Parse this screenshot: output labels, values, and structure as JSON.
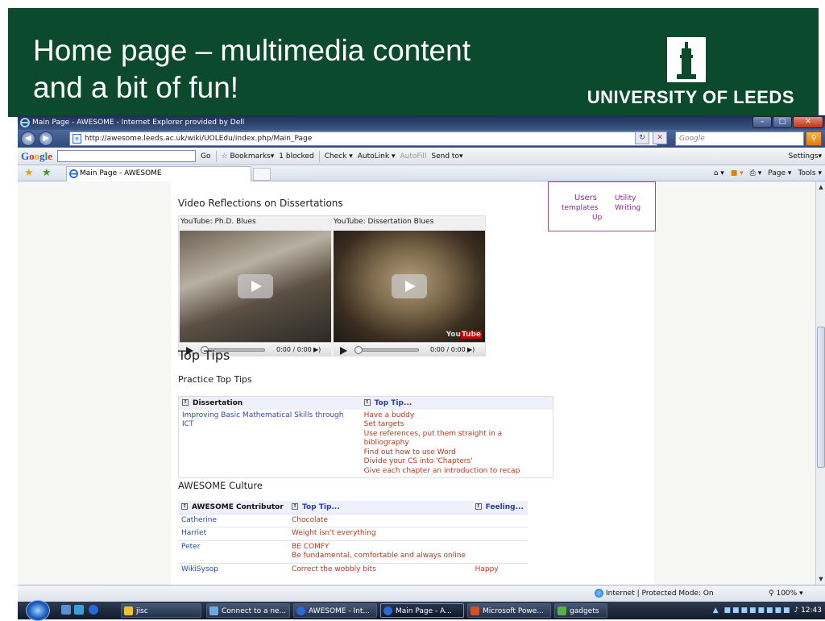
{
  "slide": {
    "title_line1": "Home page – multimedia content",
    "title_line2": "and a bit of fun!",
    "logo_text": "UNIVERSITY OF LEEDS"
  },
  "browser": {
    "window_title": "Main Page - AWESOME - Internet Explorer provided by Dell",
    "url": "http://awesome.leeds.ac.uk/wiki/UOLEdu/index.php/Main_Page",
    "search_placeholder": "Google",
    "google_toolbar": {
      "go": "Go",
      "bookmarks": "Bookmarks▾",
      "blocked": "1 blocked",
      "check": "Check ▾",
      "autolink": "AutoLink ▾",
      "autofill": "AutoFill",
      "sendto": "Send to▾",
      "settings": "Settings▾"
    },
    "tab_label": "Main Page - AWESOME",
    "command_bar": {
      "page": "Page ▾",
      "tools": "Tools ▾"
    },
    "status": {
      "zone": "Internet | Protected Mode: On",
      "zoom": "100%"
    }
  },
  "wiki": {
    "portal_box": {
      "users": "Users",
      "templates": "templates",
      "up": "Up",
      "utility": "Utility",
      "writing": "Writing"
    },
    "video_heading": "Video Reflections on Dissertations",
    "videos": [
      {
        "caption": "YouTube: Ph.D. Blues",
        "time": "0:00 / 0:00"
      },
      {
        "caption": "YouTube: Dissertation Blues",
        "time": "0:00 / 0:00"
      }
    ],
    "top_tips_heading": "Top Tips",
    "practice_heading": "Practice Top Tips",
    "tips_table": {
      "headers": [
        "Dissertation",
        "Top Tip..."
      ],
      "left_cell": "Improving Basic Mathematical Skills through ICT",
      "tips": [
        "Have a buddy",
        "Set targets",
        "Use references, put them straight in a bibliography",
        "Find out how to use Word",
        "Divide your CS into 'Chapters'",
        "Give each chapter an introduction to recap"
      ]
    },
    "culture_heading": "AWESOME Culture",
    "culture_table": {
      "headers": [
        "AWESOME Contributor",
        "Top Tip...",
        "Feeling..."
      ],
      "rows": [
        {
          "name": "Catherine",
          "tip": "Chocolate",
          "feeling": ""
        },
        {
          "name": "Harriet",
          "tip": "Weight isn't everything",
          "feeling": ""
        },
        {
          "name": "Peter",
          "tip": "BE COMFY",
          "tip2": "Be fundamental, comfortable and always online",
          "feeling": ""
        },
        {
          "name": "WikiSysop",
          "tip": "Correct the wobbly bits",
          "feeling": "Happy"
        }
      ]
    }
  },
  "taskbar": {
    "items": [
      {
        "label": "jisc"
      },
      {
        "label": "Connect to a ne..."
      },
      {
        "label": "AWESOME - Int..."
      },
      {
        "label": "Main Page - A..."
      },
      {
        "label": "Microsoft Powe..."
      },
      {
        "label": "gadgets"
      }
    ],
    "clock": "12:43"
  },
  "colors": {
    "slide_green": "#0b4a2c",
    "link_blue": "#2a4aa8",
    "link_red": "#b8381a"
  }
}
